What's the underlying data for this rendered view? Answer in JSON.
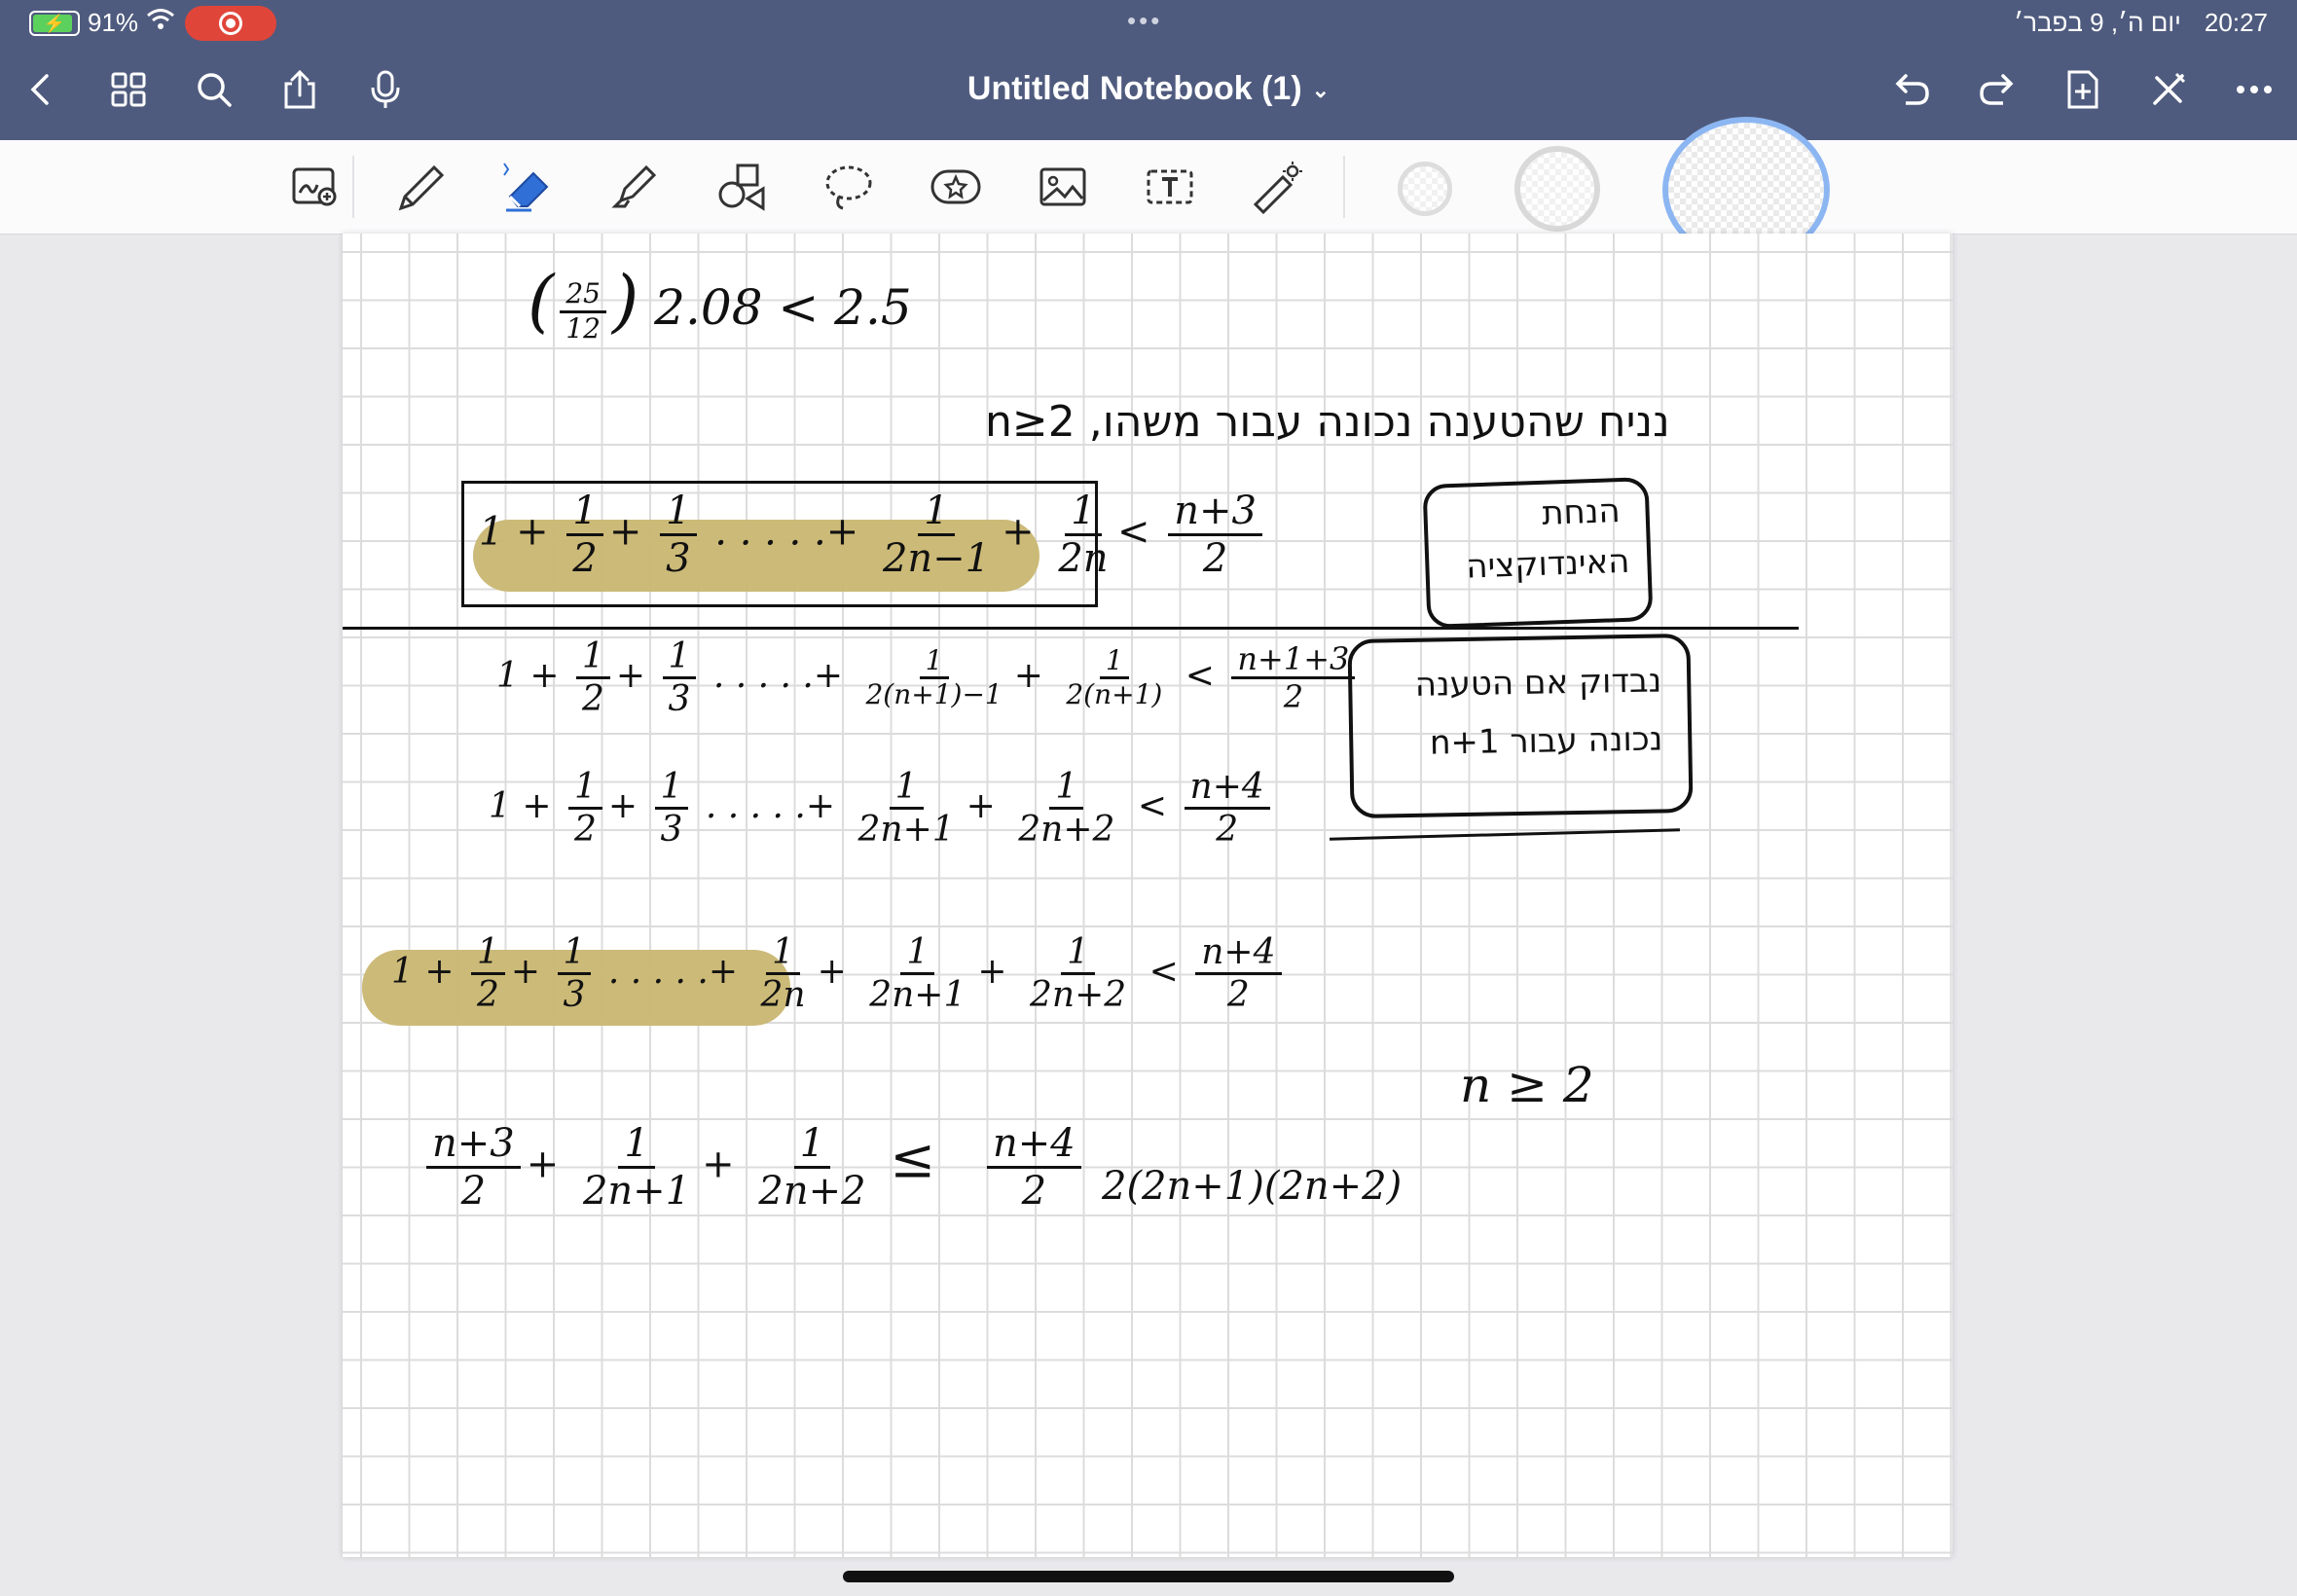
{
  "status_bar": {
    "battery": "91%",
    "date": "יום ה׳, 9 בפבר׳",
    "time": "20:27",
    "dots": "•••"
  },
  "header": {
    "title": "Untitled Notebook (1)",
    "title_chevron": "⌄"
  },
  "colors": {
    "top_bar": "#4f5b7e",
    "highlight": "#c9b671",
    "record": "#e0453a",
    "eraser": "#2f6fd6"
  },
  "icons": {
    "left": [
      "back-icon",
      "grid-icon",
      "search-icon",
      "share-icon",
      "mic-icon"
    ],
    "right": [
      "undo-icon",
      "redo-icon",
      "add-page-icon",
      "close-pen-icon",
      "more-icon"
    ],
    "tools": [
      "zoom-window-icon",
      "pen-icon",
      "eraser-icon",
      "highlighter-icon",
      "shapes-icon",
      "lasso-icon",
      "sticker-icon",
      "image-icon",
      "text-icon",
      "laser-icon"
    ]
  },
  "notes": {
    "line1": "2.08 < 2.5",
    "line1_frac_num": "25",
    "line1_frac_den": "12",
    "heb_assumption": "נניח שהטענה נכונה עבור משהו, n≥2",
    "box1_heb_a": "הנחת",
    "box1_heb_b": "האינדוקציה",
    "ind_lhs_start": "1 +",
    "n1": "1",
    "d2": "2",
    "d3": "3",
    "dots": ". . . . .",
    "plus": "+",
    "d_2n_1": "2n−1",
    "d_2n": "2n",
    "lt": "<",
    "rhs_n3": "n+3",
    "rhs_2": "2",
    "box2_heb_a": "נבדוק אם הטענה",
    "box2_heb_b": "נכונה עבור n+1",
    "row2_d1": "2(n+1)−1",
    "row2_d2": "2(n+1)",
    "row2_rhs": "n+1+3",
    "d_2n1": "2n+1",
    "d_2n2": "2n+2",
    "rhs_n4": "n+4",
    "n_ge_2": "n ≥ 2",
    "last_lhs_num": "n+3",
    "le": "≤",
    "factor": "2(2n+1)(2n+2)"
  }
}
